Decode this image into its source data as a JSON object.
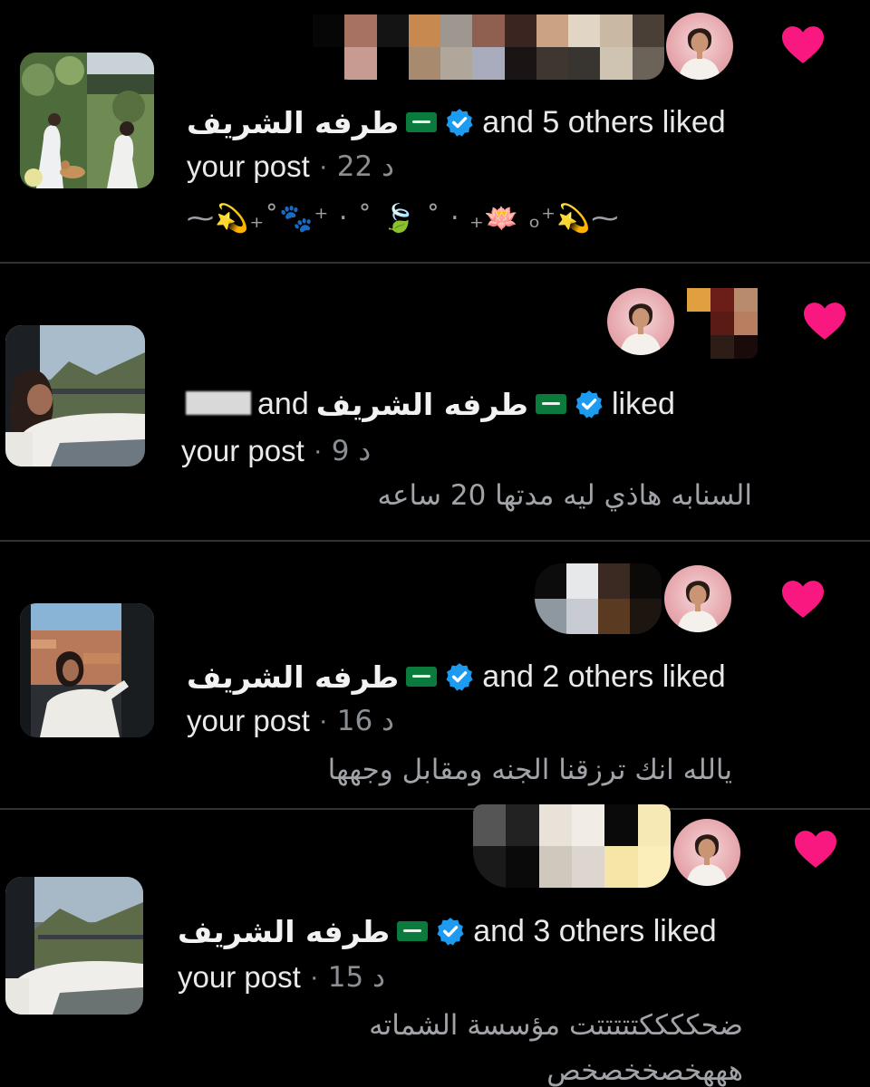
{
  "colors": {
    "background": "#000000",
    "heart": "#f91880",
    "verified": "#1d9bf0",
    "text_primary": "#e7e9ea",
    "text_secondary": "#8b8f94",
    "divider": "#2f3336",
    "avatar_bg": "#eab3b8"
  },
  "notifications": [
    {
      "icon": "heart-icon",
      "user_name": "طرفه الشريف",
      "flag": "saudi-flag-icon",
      "badge": "verified-badge-icon",
      "action": "and 5 others liked",
      "object": "your post",
      "separator": "·",
      "time": "22 د",
      "snippet": "⁓💫₊˚🐾⁺ ‧ ˚ 🍃 ˚ ‧ ₊🪷 ₒ⁺💫⁓"
    },
    {
      "icon": "heart-icon",
      "user_name": "طرفه الشريف",
      "flag": "saudi-flag-icon",
      "badge": "verified-badge-icon",
      "action_prefix": "and",
      "action": "liked",
      "object": "your post",
      "separator": "·",
      "time": "9 د",
      "snippet": "السنابه هاذي ليه مدتها 20 ساعه"
    },
    {
      "icon": "heart-icon",
      "user_name": "طرفه الشريف",
      "flag": "saudi-flag-icon",
      "badge": "verified-badge-icon",
      "action": "and 2 others liked",
      "object": "your post",
      "separator": "·",
      "time": "16 د",
      "snippet": "يالله انك ترزقنا الجنه ومقابل وجهها"
    },
    {
      "icon": "heart-icon",
      "user_name": "طرفه الشريف",
      "flag": "saudi-flag-icon",
      "badge": "verified-badge-icon",
      "action": "and 3 others liked",
      "object": "your post",
      "separator": "·",
      "time": "15 د",
      "snippet": "ضحككككتتتتتت مؤسسة الشماته",
      "snippet_line2": "هههخصخخصخص"
    }
  ]
}
